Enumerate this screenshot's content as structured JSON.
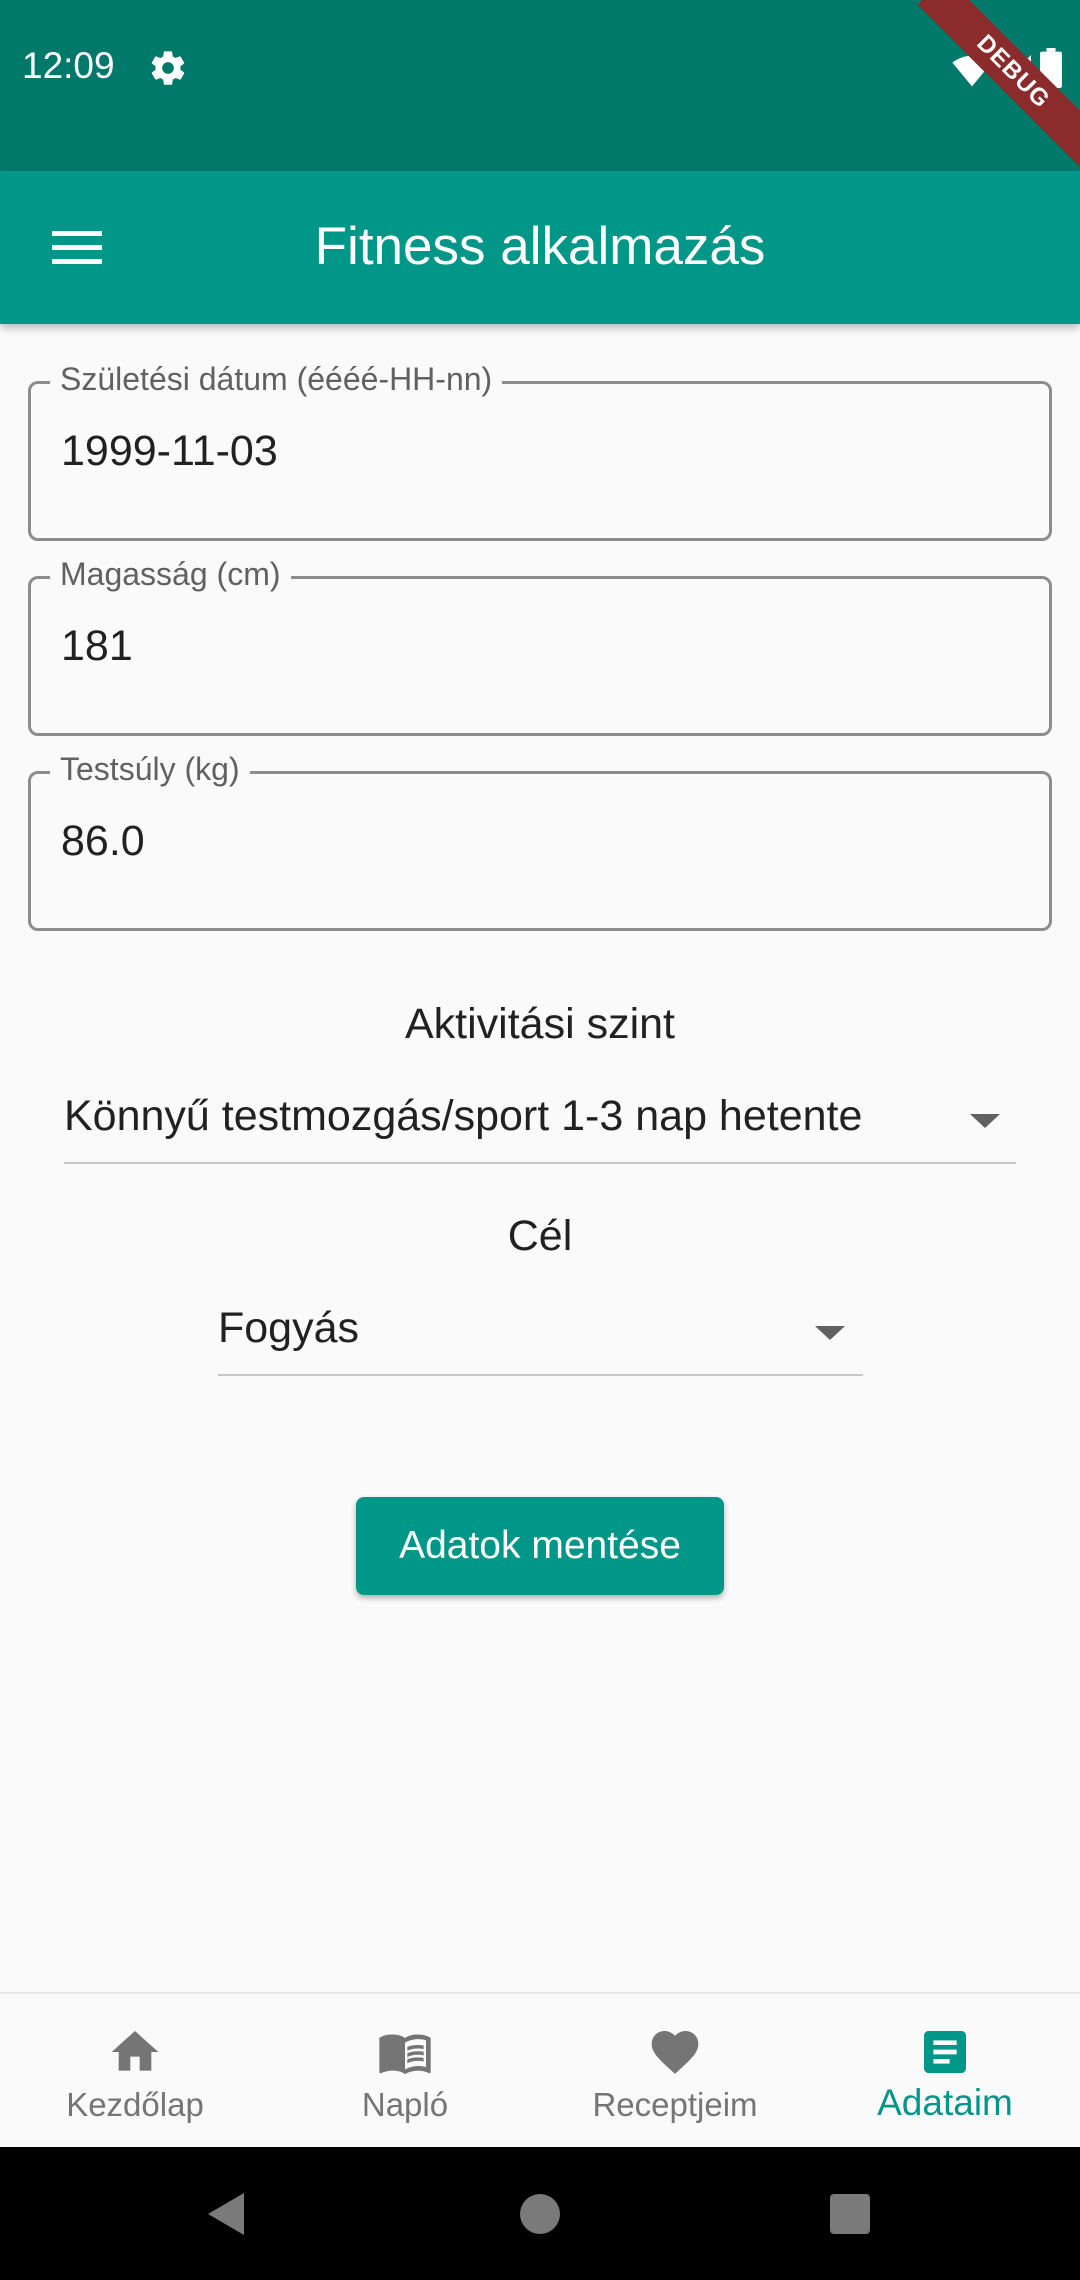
{
  "status_bar": {
    "time": "12:09",
    "debug_label": "DEBUG"
  },
  "app_bar": {
    "title": "Fitness alkalmazás"
  },
  "form": {
    "birth_date": {
      "label": "Születési dátum (éééé-HH-nn)",
      "value": "1999-11-03"
    },
    "height": {
      "label": "Magasság (cm)",
      "value": "181"
    },
    "weight": {
      "label": "Testsúly (kg)",
      "value": "86.0"
    },
    "activity": {
      "label": "Aktivitási szint",
      "selected": "Könnyű testmozgás/sport 1-3 nap hetente"
    },
    "goal": {
      "label": "Cél",
      "selected": "Fogyás"
    },
    "save_label": "Adatok mentése"
  },
  "bottom_nav": {
    "items": [
      {
        "label": "Kezdőlap",
        "icon": "home-icon"
      },
      {
        "label": "Napló",
        "icon": "book-icon"
      },
      {
        "label": "Receptjeim",
        "icon": "heart-icon"
      },
      {
        "label": "Adataim",
        "icon": "document-icon",
        "active": true
      }
    ]
  },
  "colors": {
    "primary": "#009688",
    "primary_dark": "#00796b",
    "inactive": "#757575"
  }
}
